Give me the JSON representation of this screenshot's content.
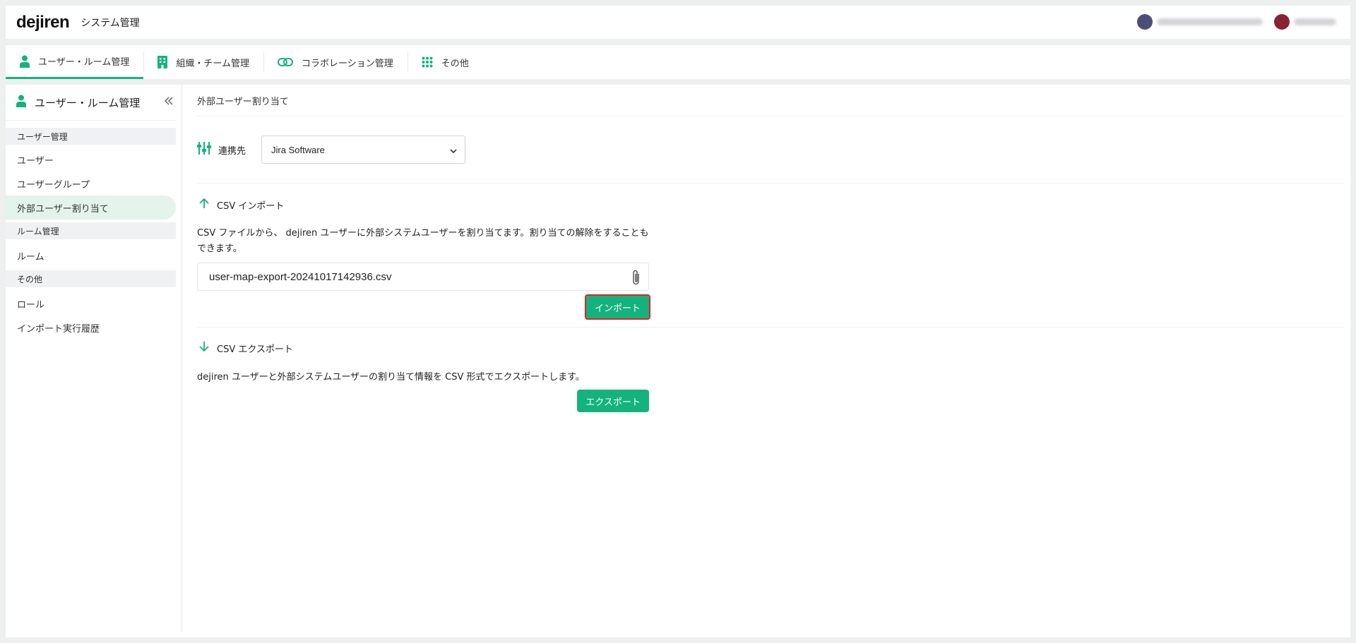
{
  "header": {
    "logo": "dejiren",
    "title": "システム管理"
  },
  "tabs": [
    {
      "label": "ユーザー・ルーム管理",
      "icon": "person-icon",
      "active": true
    },
    {
      "label": "組織・チーム管理",
      "icon": "building-icon",
      "active": false
    },
    {
      "label": "コラボレーション管理",
      "icon": "link-icon",
      "active": false
    },
    {
      "label": "その他",
      "icon": "grid-icon",
      "active": false
    }
  ],
  "sidebar": {
    "title": "ユーザー・ルーム管理",
    "sections": [
      {
        "label": "ユーザー管理",
        "items": [
          "ユーザー",
          "ユーザーグループ",
          "外部ユーザー割り当て"
        ]
      },
      {
        "label": "ルーム管理",
        "items": [
          "ルーム"
        ]
      },
      {
        "label": "その他",
        "items": [
          "ロール",
          "インポート実行履歴"
        ]
      }
    ],
    "active_item": "外部ユーザー割り当て"
  },
  "main": {
    "page_title": "外部ユーザー割り当て",
    "connect_label": "連携先",
    "connect_value": "Jira Software",
    "import": {
      "heading": "CSV インポート",
      "description": "CSV ファイルから、 dejiren ユーザーに外部システムユーザーを割り当てます。割り当ての解除をすることもできます。",
      "file_name": "user-map-export-20241017142936.csv",
      "button": "インポート"
    },
    "export": {
      "heading": "CSV エクスポート",
      "description": "dejiren ユーザーと外部システムユーザーの割り当て情報を CSV 形式でエクスポートします。",
      "button": "エクスポート"
    }
  },
  "colors": {
    "accent": "#14b37d",
    "highlight_border": "#d9252a"
  }
}
